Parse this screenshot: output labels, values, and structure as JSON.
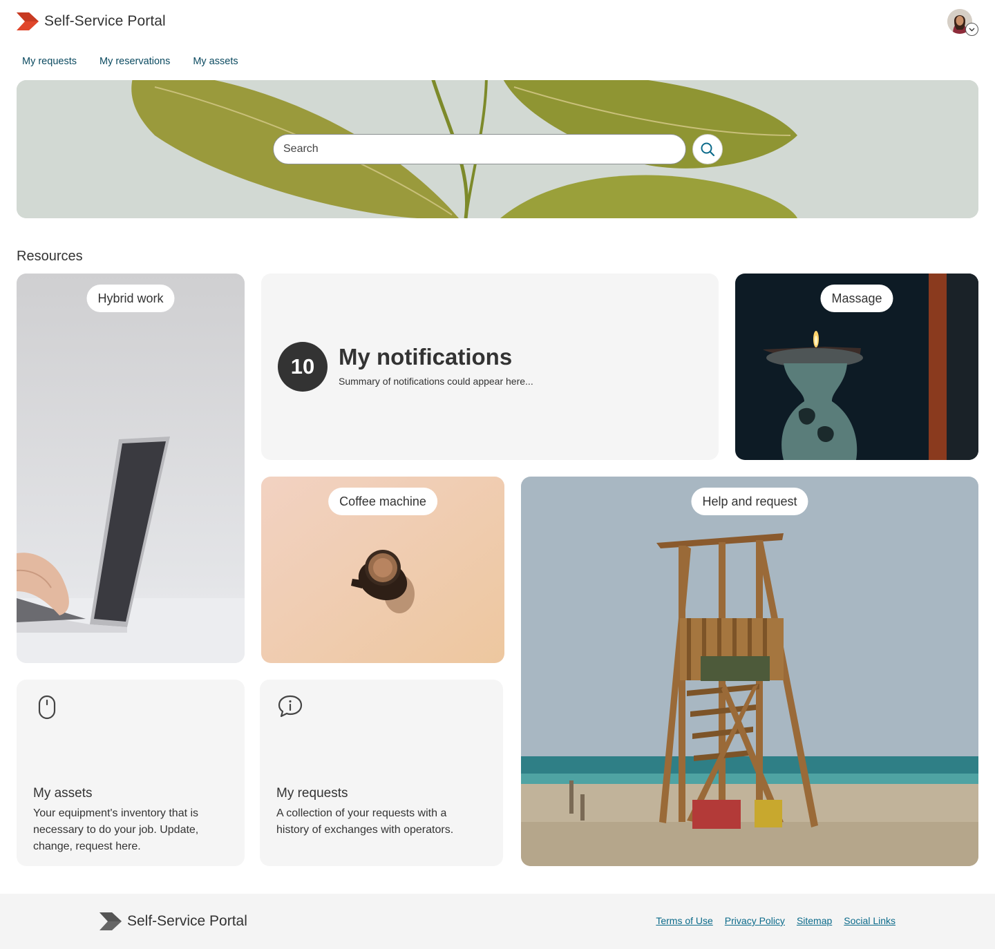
{
  "header": {
    "title": "Self-Service Portal",
    "logo_icon": "chevron-logo-icon",
    "brand_color": "#e0462b",
    "avatar_icon": "user-avatar",
    "avatar_menu_icon": "chevron-down-icon"
  },
  "nav": {
    "items": [
      {
        "label": "My requests"
      },
      {
        "label": "My reservations"
      },
      {
        "label": "My assets"
      }
    ]
  },
  "hero": {
    "search_placeholder": "Search",
    "search_icon": "search-icon",
    "accent_color": "#0b6a8a"
  },
  "resources": {
    "title": "Resources",
    "hybrid_work": {
      "label": "Hybrid work"
    },
    "notifications": {
      "count": "10",
      "title": "My notifications",
      "summary": "Summary of notifications could appear here..."
    },
    "massage": {
      "label": "Massage"
    },
    "coffee": {
      "label": "Coffee machine"
    },
    "help": {
      "label": "Help and request"
    },
    "assets": {
      "icon": "mouse-icon",
      "title": "My assets",
      "description": "Your equipment's inventory that is necessary to do your job. Update, change, request here."
    },
    "requests": {
      "icon": "info-chat-icon",
      "title": "My requests",
      "description": "A collection of your requests with a history of exchanges with operators."
    }
  },
  "footer": {
    "title": "Self-Service Portal",
    "logo_color": "#555555",
    "links": [
      {
        "label": "Terms of Use"
      },
      {
        "label": "Privacy Policy"
      },
      {
        "label": "Sitemap"
      },
      {
        "label": "Social Links"
      }
    ]
  }
}
